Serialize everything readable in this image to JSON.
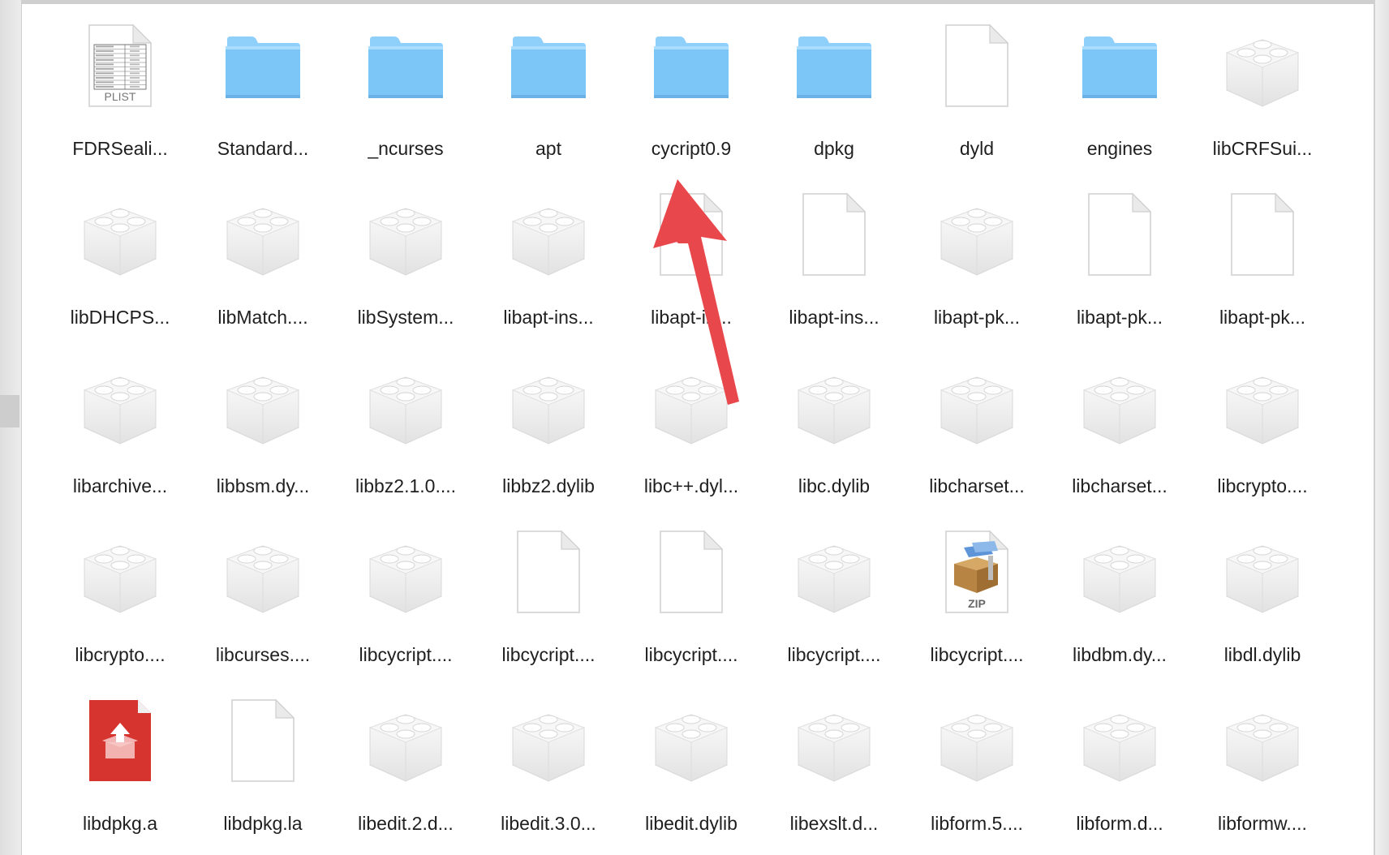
{
  "finder": {
    "items": [
      {
        "label": "FDRSeali...",
        "icon": "plist-file-icon",
        "icon_text": "PLIST"
      },
      {
        "label": "Standard...",
        "icon": "folder-icon"
      },
      {
        "label": "_ncurses",
        "icon": "folder-icon"
      },
      {
        "label": "apt",
        "icon": "folder-icon"
      },
      {
        "label": "cycript0.9",
        "icon": "folder-icon"
      },
      {
        "label": "dpkg",
        "icon": "folder-icon"
      },
      {
        "label": "dyld",
        "icon": "blank-file-icon"
      },
      {
        "label": "engines",
        "icon": "folder-icon"
      },
      {
        "label": "libCRFSui...",
        "icon": "library-lego-icon"
      },
      {
        "label": "libDHCPS...",
        "icon": "library-lego-icon"
      },
      {
        "label": "libMatch....",
        "icon": "library-lego-icon"
      },
      {
        "label": "libSystem...",
        "icon": "library-lego-icon"
      },
      {
        "label": "libapt-ins...",
        "icon": "library-lego-icon"
      },
      {
        "label": "libapt-in...",
        "icon": "blank-file-icon"
      },
      {
        "label": "libapt-ins...",
        "icon": "blank-file-icon"
      },
      {
        "label": "libapt-pk...",
        "icon": "library-lego-icon"
      },
      {
        "label": "libapt-pk...",
        "icon": "blank-file-icon"
      },
      {
        "label": "libapt-pk...",
        "icon": "blank-file-icon"
      },
      {
        "label": "libarchive...",
        "icon": "library-lego-icon"
      },
      {
        "label": "libbsm.dy...",
        "icon": "library-lego-icon"
      },
      {
        "label": "libbz2.1.0....",
        "icon": "library-lego-icon"
      },
      {
        "label": "libbz2.dylib",
        "icon": "library-lego-icon"
      },
      {
        "label": "libc++.dyl...",
        "icon": "library-lego-icon"
      },
      {
        "label": "libc.dylib",
        "icon": "library-lego-icon"
      },
      {
        "label": "libcharset...",
        "icon": "library-lego-icon"
      },
      {
        "label": "libcharset...",
        "icon": "library-lego-icon"
      },
      {
        "label": "libcrypto....",
        "icon": "library-lego-icon"
      },
      {
        "label": "libcrypto....",
        "icon": "library-lego-icon"
      },
      {
        "label": "libcurses....",
        "icon": "library-lego-icon"
      },
      {
        "label": "libcycript....",
        "icon": "library-lego-icon"
      },
      {
        "label": "libcycript....",
        "icon": "blank-file-icon"
      },
      {
        "label": "libcycript....",
        "icon": "blank-file-icon"
      },
      {
        "label": "libcycript....",
        "icon": "library-lego-icon"
      },
      {
        "label": "libcycript....",
        "icon": "zip-archive-icon",
        "icon_text": "ZIP"
      },
      {
        "label": "libdbm.dy...",
        "icon": "library-lego-icon"
      },
      {
        "label": "libdl.dylib",
        "icon": "library-lego-icon"
      },
      {
        "label": "libdpkg.a",
        "icon": "archive-red-icon"
      },
      {
        "label": "libdpkg.la",
        "icon": "blank-file-icon"
      },
      {
        "label": "libedit.2.d...",
        "icon": "library-lego-icon"
      },
      {
        "label": "libedit.3.0...",
        "icon": "library-lego-icon"
      },
      {
        "label": "libedit.dylib",
        "icon": "library-lego-icon"
      },
      {
        "label": "libexslt.d...",
        "icon": "library-lego-icon"
      },
      {
        "label": "libform.5....",
        "icon": "library-lego-icon"
      },
      {
        "label": "libform.d...",
        "icon": "library-lego-icon"
      },
      {
        "label": "libformw....",
        "icon": "library-lego-icon"
      }
    ]
  },
  "annotation": {
    "icon": "red-arrow-icon",
    "color": "#e8474b"
  },
  "colors": {
    "folder_top": "#8fd0fb",
    "folder_body": "#7cc5f7",
    "lego": "#eeeeee"
  }
}
